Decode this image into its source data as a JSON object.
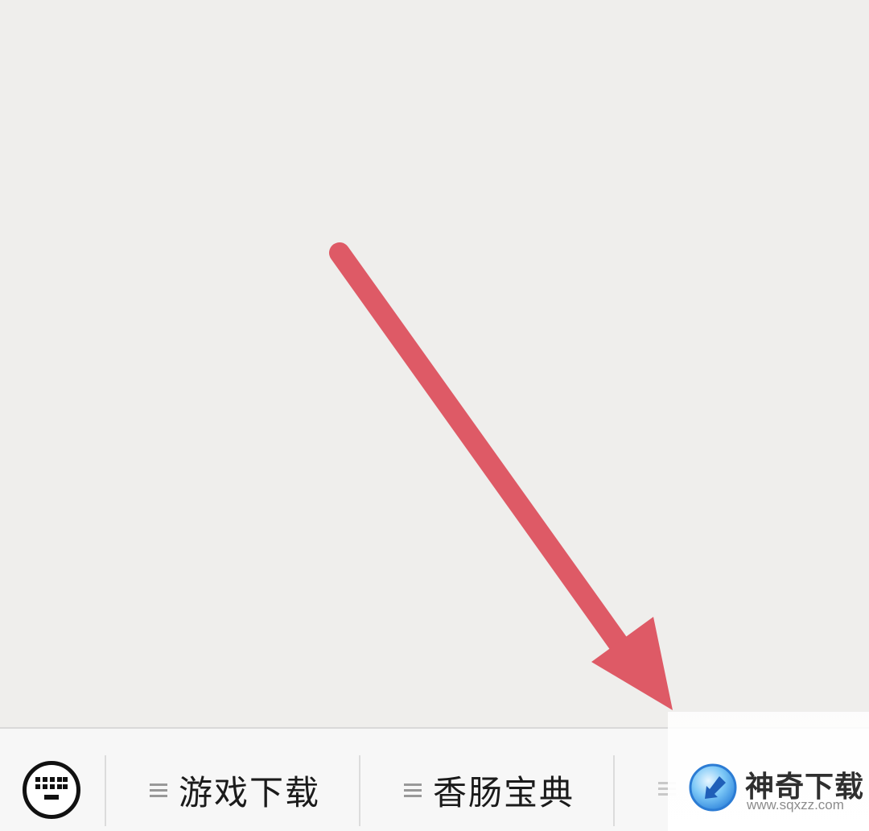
{
  "menu_bar": {
    "keyboard_toggle_icon": "keyboard-icon",
    "items": [
      {
        "label": "游戏下载",
        "icon": "hamburger-icon"
      },
      {
        "label": "香肠宝典",
        "icon": "hamburger-icon"
      },
      {
        "label": "",
        "icon": "hamburger-icon"
      }
    ]
  },
  "annotation": {
    "arrow_color": "#de5a66"
  },
  "watermark": {
    "name": "神奇下载",
    "url": "www.sqxzz.com",
    "logo_colors": [
      "#3b8fe0",
      "#7cc8f7"
    ]
  }
}
